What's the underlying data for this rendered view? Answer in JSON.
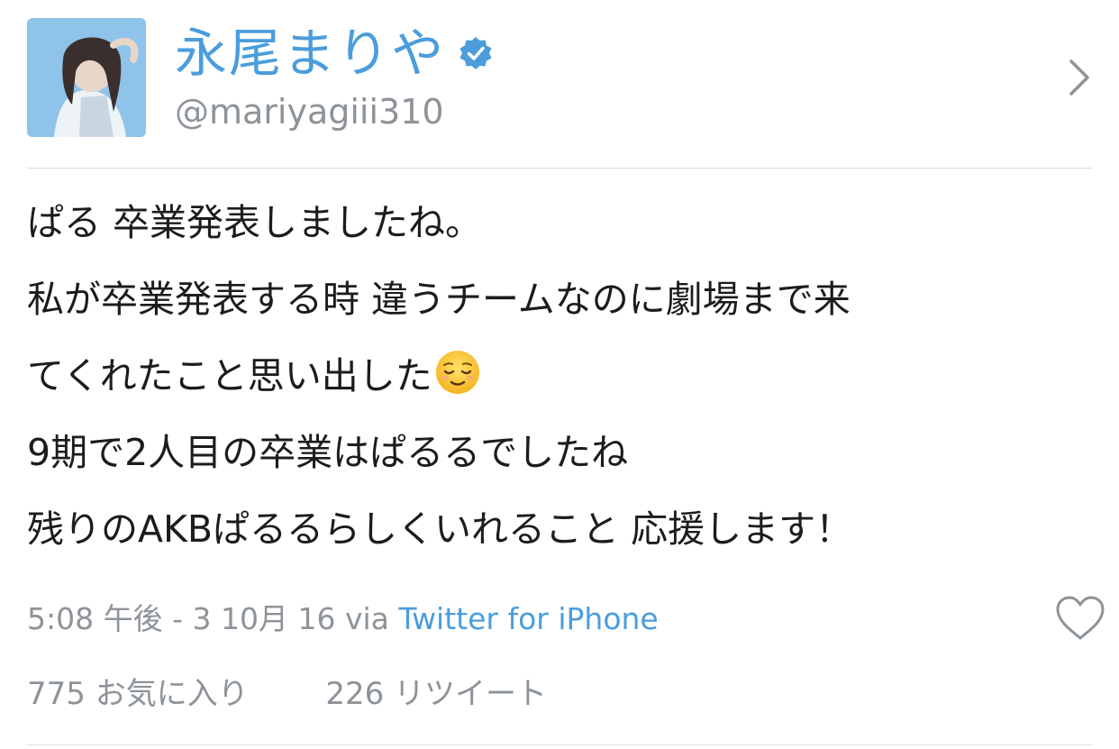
{
  "user": {
    "display_name": "永尾まりや",
    "handle": "@mariyagiii310",
    "verified_icon": "verified-badge-icon",
    "avatar_icon": "avatar"
  },
  "tweet": {
    "lines": [
      "ぱる 卒業発表しましたね。",
      "私が卒業発表する時 違うチームなのに劇場まで来",
      "てくれたこと思い出した",
      "9期で2人目の卒業はぱるるでしたね",
      "残りのAKBぱるるらしくいれること 応援します！"
    ],
    "emoji": "relieved-face-icon"
  },
  "meta": {
    "timestamp": "5:08 午後 - 3 10月 16",
    "via": "via",
    "source": "Twitter for iPhone"
  },
  "stats": {
    "favorites_count": "775",
    "favorites_label": "お気に入り",
    "retweets_count": "226",
    "retweets_label": "リツイート"
  },
  "colors": {
    "accent": "#4b9ddc",
    "muted": "#8d9399",
    "text": "#1c1c1e",
    "divider": "#d9dce0"
  }
}
